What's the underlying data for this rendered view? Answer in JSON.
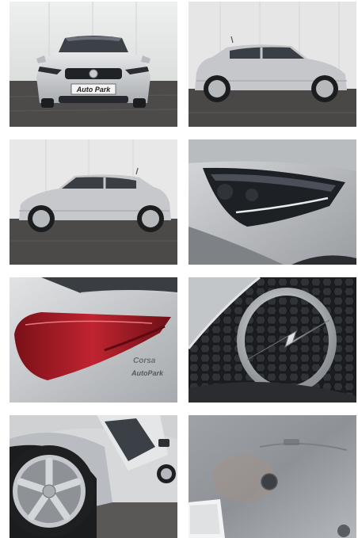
{
  "gallery": {
    "photos": [
      {
        "view": "front"
      },
      {
        "view": "side-right"
      },
      {
        "view": "side-left"
      },
      {
        "view": "headlight-detail"
      },
      {
        "view": "taillight-detail"
      },
      {
        "view": "badge-detail"
      },
      {
        "view": "wheel-detail"
      },
      {
        "view": "paint-detail"
      }
    ],
    "dealer_plate": "Auto Park",
    "dealer_badge": "AutoPark",
    "model_badge": "Corsa"
  },
  "colors": {
    "car_silver": "#c8cacd",
    "wall": "#e4e5e4",
    "pavement": "#4a4846",
    "taillight_red": "#b0202a"
  }
}
